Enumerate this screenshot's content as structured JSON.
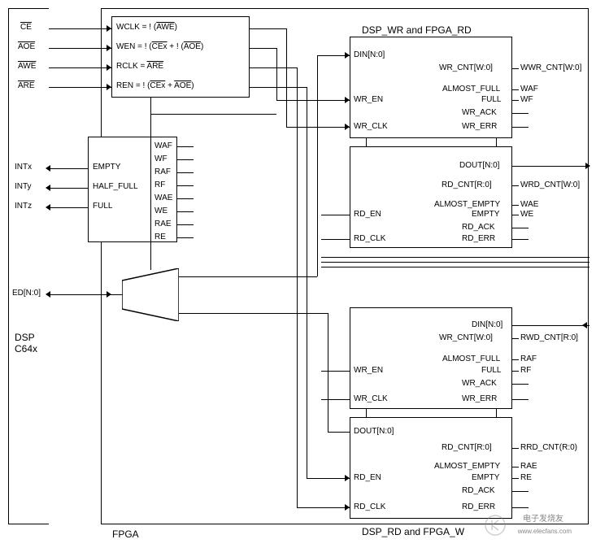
{
  "dsp": {
    "name": "DSP\nC64x",
    "signals": {
      "ce": "CE",
      "aoe": "AOE",
      "awe": "AWE",
      "are": "ARE",
      "intx": "INTx",
      "inty": "INTy",
      "intz": "INTz",
      "ed": "ED[N:0]"
    }
  },
  "fpga": {
    "name": "FPGA"
  },
  "clockgen": {
    "wclk": "WCLK = ! (AWE)",
    "wen": "WEN = ! (CEx + ! (AOE)",
    "rclk": "RCLK = ARE",
    "ren": "REN = ! (CEx + AOE)"
  },
  "status": {
    "empty": "EMPTY",
    "half_full": "HALF_FULL",
    "full": "FULL",
    "flags": [
      "WAF",
      "WF",
      "RAF",
      "RF",
      "WAE",
      "WE",
      "RAE",
      "RE"
    ]
  },
  "fifo_wr": {
    "title": "DSP_WR and FPGA_RD",
    "write": {
      "din": "DIN[N:0]",
      "wr_cnt": "WR_CNT[W:0]",
      "almost_full": "ALMOST_FULL",
      "wr_en": "WR_EN",
      "full": "FULL",
      "wr_ack": "WR_ACK",
      "wr_clk": "WR_CLK",
      "wr_err": "WR_ERR"
    },
    "write_out": {
      "wwr_cnt": "WWR_CNT[W:0]",
      "waf": "WAF",
      "wf": "WF"
    },
    "read": {
      "dout": "DOUT[N:0]",
      "rd_cnt": "RD_CNT[R:0]",
      "almost_empty": "ALMOST_EMPTY",
      "rd_en": "RD_EN",
      "empty": "EMPTY",
      "rd_ack": "RD_ACK",
      "rd_clk": "RD_CLK",
      "rd_err": "RD_ERR"
    },
    "read_out": {
      "wrd_cnt": "WRD_CNT[W:0]",
      "wae": "WAE",
      "we": "WE"
    }
  },
  "fifo_rd": {
    "title": "DSP_RD and FPGA_W",
    "write": {
      "din": "DIN[N:0]",
      "wr_cnt": "WR_CNT[W:0]",
      "almost_full": "ALMOST_FULL",
      "wr_en": "WR_EN",
      "full": "FULL",
      "wr_ack": "WR_ACK",
      "wr_clk": "WR_CLK",
      "wr_err": "WR_ERR"
    },
    "write_out": {
      "rwd_cnt": "RWD_CNT[R:0]",
      "raf": "RAF",
      "rf": "RF"
    },
    "read": {
      "dout": "DOUT[N:0]",
      "rd_cnt": "RD_CNT[R:0]",
      "almost_empty": "ALMOST_EMPTY",
      "rd_en": "RD_EN",
      "empty": "EMPTY",
      "rd_ack": "RD_ACK",
      "rd_clk": "RD_CLK",
      "rd_err": "RD_ERR"
    },
    "read_out": {
      "rrd_cnt": "RRD_CNT(R:0)",
      "rae": "RAE",
      "re": "RE"
    }
  },
  "watermark": {
    "brand": "电子发烧友",
    "url": "www.elecfans.com"
  }
}
